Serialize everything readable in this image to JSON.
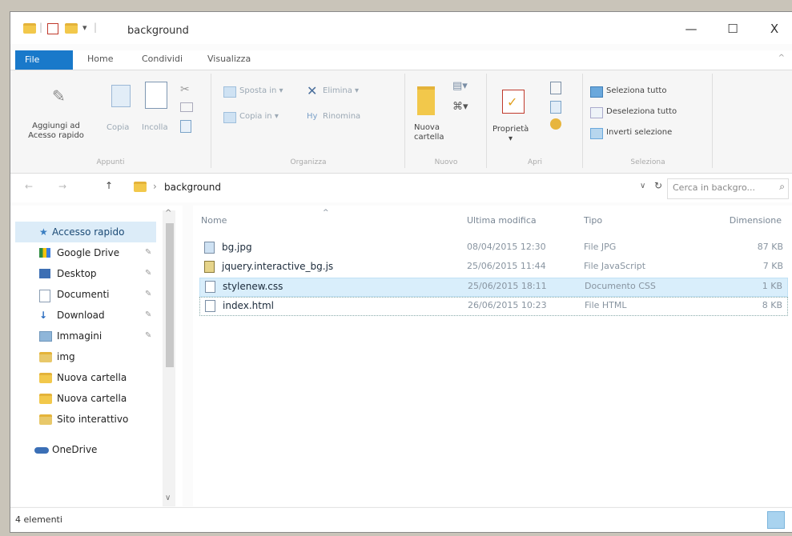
{
  "title_bar": {
    "title": "background",
    "quick_access_separator": "|",
    "quick_access_arrow": "▾",
    "minimize": "—",
    "maximize": "☐",
    "close": "X"
  },
  "tabs": {
    "file": "File",
    "home": "Home",
    "share": "Condividi",
    "view": "Visualizza",
    "collapse": "^"
  },
  "ribbon": {
    "appunti": {
      "label": "Appunti",
      "pin": "Aggiungi ad Acesso rapido",
      "copy": "Copia",
      "paste": "Incolla"
    },
    "organizza": {
      "label": "Organizza",
      "move_to": "Sposta in ▾",
      "copy_to": "Copia in ▾",
      "delete": "Elimina ▾",
      "rename": "Rinomina"
    },
    "nuovo": {
      "label": "Nuovo",
      "new_folder": "Nuova cartella"
    },
    "apri": {
      "label": "Apri",
      "properties": "Proprietà",
      "properties_arrow": "▾"
    },
    "seleziona": {
      "label": "Seleziona",
      "select_all": "Seleziona tutto",
      "deselect_all": "Deseleziona tutto",
      "invert": "Inverti selezione"
    }
  },
  "address": {
    "back": "←",
    "forward": "→",
    "up": "↑",
    "sep": "›",
    "path": "background",
    "dropdown": "∨",
    "refresh": "↻",
    "search_placeholder": "Cerca in backgro...",
    "search_glyph": "⌕"
  },
  "nav": {
    "items": [
      {
        "label": "Accesso rapido",
        "pinned": false,
        "pin": ""
      },
      {
        "label": "Google Drive",
        "pinned": true,
        "pin": "✎"
      },
      {
        "label": "Desktop",
        "pinned": true,
        "pin": "✎"
      },
      {
        "label": "Documenti",
        "pinned": true,
        "pin": "✎"
      },
      {
        "label": "Download",
        "pinned": true,
        "pin": "✎"
      },
      {
        "label": "Immagini",
        "pinned": true,
        "pin": "✎"
      },
      {
        "label": "img",
        "pinned": false,
        "pin": ""
      },
      {
        "label": "Nuova cartella",
        "pinned": false,
        "pin": ""
      },
      {
        "label": "Nuova cartella",
        "pinned": false,
        "pin": ""
      },
      {
        "label": "Sito interattivo",
        "pinned": false,
        "pin": ""
      },
      {
        "label": "OneDrive",
        "pinned": false,
        "pin": ""
      }
    ],
    "scroll_up": "^",
    "scroll_down": "∨"
  },
  "columns": {
    "name": "Nome",
    "modified": "Ultima modifica",
    "type": "Tipo",
    "size": "Dimensione",
    "sort_glyph": "^"
  },
  "files": [
    {
      "name": "bg.jpg",
      "modified": "08/04/2015 12:30",
      "type": "File JPG",
      "size": "87 KB"
    },
    {
      "name": "jquery.interactive_bg.js",
      "modified": "25/06/2015 11:44",
      "type": "File JavaScript",
      "size": "7 KB"
    },
    {
      "name": "stylenew.css",
      "modified": "25/06/2015 18:11",
      "type": "Documento CSS",
      "size": "1 KB"
    },
    {
      "name": "index.html",
      "modified": "26/06/2015 10:23",
      "type": "File HTML",
      "size": "8 KB"
    }
  ],
  "status": {
    "count": "4 elementi"
  },
  "colors": {
    "accent": "#1979ca",
    "selection": "#d9eefb",
    "folder": "#f2c84b"
  }
}
